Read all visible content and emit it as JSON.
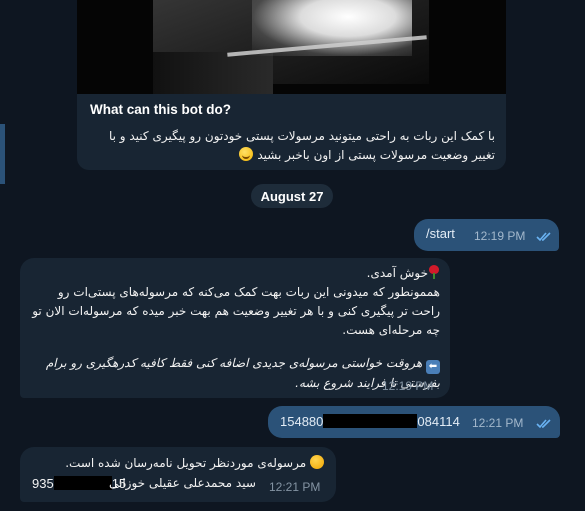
{
  "intro": {
    "heading": "What can this bot do?",
    "body": "با کمک این ربات به راحتی میتونید مرسولات پستی خودتون رو پیگیری کنید و با تغییر وضعیت مرسولات پستی از اون باخبر بشید",
    "emoji": "grinning-face-icon"
  },
  "date_separator": "August 27",
  "messages": {
    "start": {
      "text": "/start",
      "time": "12:19 PM",
      "status": "read"
    },
    "welcome": {
      "line1": "خوش آمدی.",
      "para1": "هممونطور که میدونی این ربات بهت کمک می‌کنه که مرسوله‌های پستی‌ات رو راحت تر پیگیری کنی و با هر تغییر وضعیت هم بهت خبر میده که مرسوله‌ات الان تو چه مرحله‌ای هست.",
      "para2": "هروقت خواستی مرسوله‌ی جدیدی اضافه کنی فقط کافیه کدرهگیری رو برام بفرستی تا فرایند شروع بشه.",
      "time": "12:19 PM"
    },
    "tracking": {
      "prefix": "154880",
      "suffix": "084114",
      "time": "12:21 PM",
      "status": "read"
    },
    "status_msg": {
      "line1": "مرسوله‌ی موردنظر تحویل نامه‌رسان شده است.",
      "name": "سید محمدعلی عقیلی خوزانی",
      "num_prefix": "935",
      "num_suffix": "15",
      "time": "12:21 PM"
    }
  },
  "colors": {
    "background": "#0e1621",
    "incoming": "#182533",
    "outgoing": "#2b5278",
    "read_ticks": "#6ab3f3"
  }
}
